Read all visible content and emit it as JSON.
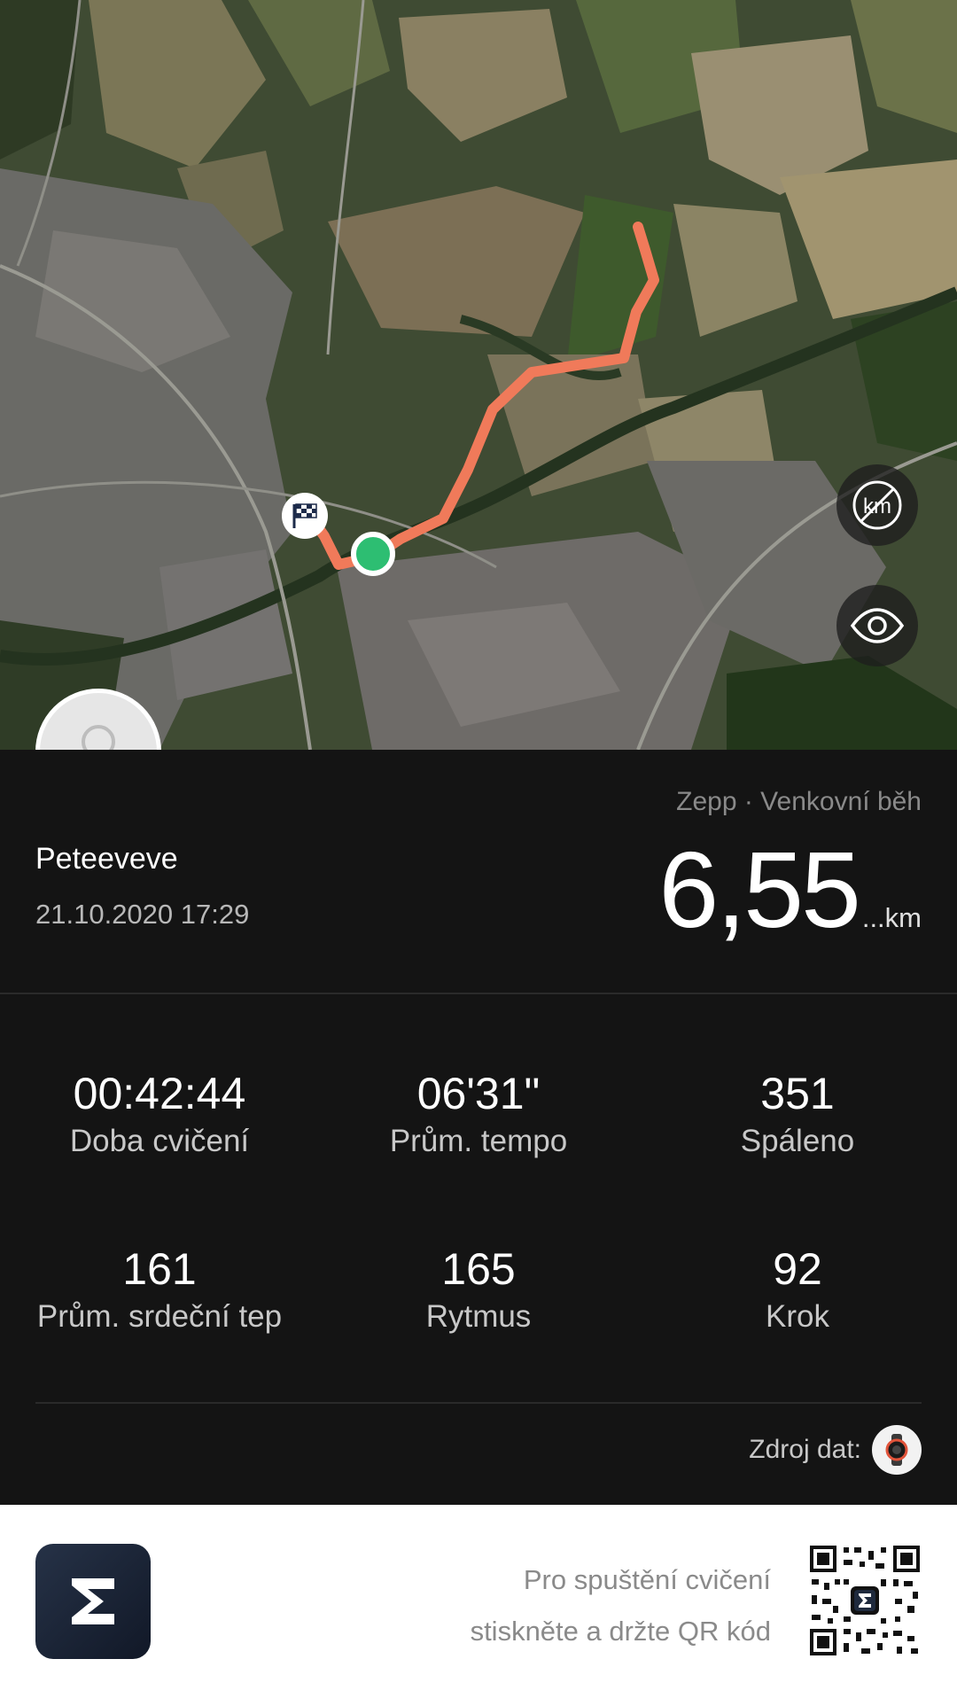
{
  "map": {
    "route_color": "#F07A5A",
    "start_color": "#2DBE72",
    "finish_icon": "checkered-flag-icon",
    "buttons": [
      {
        "name": "hide-km-markers-button",
        "icon": "km-off-icon"
      },
      {
        "name": "visibility-button",
        "icon": "eye-icon"
      }
    ]
  },
  "profile": {
    "avatar_icon": "user-avatar-icon",
    "name": "Peteeveve",
    "datetime": "21.10.2020 17:29"
  },
  "activity": {
    "source": "Zepp · Venkovní běh",
    "distance": "6,55",
    "unit": "...km"
  },
  "stats": [
    {
      "value": "00:42:44",
      "label": "Doba cvičení"
    },
    {
      "value": "06'31\"",
      "label": "Prům. tempo"
    },
    {
      "value": "351",
      "label": "Spáleno"
    },
    {
      "value": "161",
      "label": "Prům. srdeční tep"
    },
    {
      "value": "165",
      "label": "Rytmus"
    },
    {
      "value": "92",
      "label": "Krok"
    }
  ],
  "data_source": {
    "label": "Zdroj dat:",
    "device_icon": "watch-icon"
  },
  "footer": {
    "app_icon": "zepp-logo-icon",
    "line1": "Pro spuštění cvičení",
    "line2": "stiskněte a držte QR kód",
    "qr_icon": "qr-code-icon"
  }
}
